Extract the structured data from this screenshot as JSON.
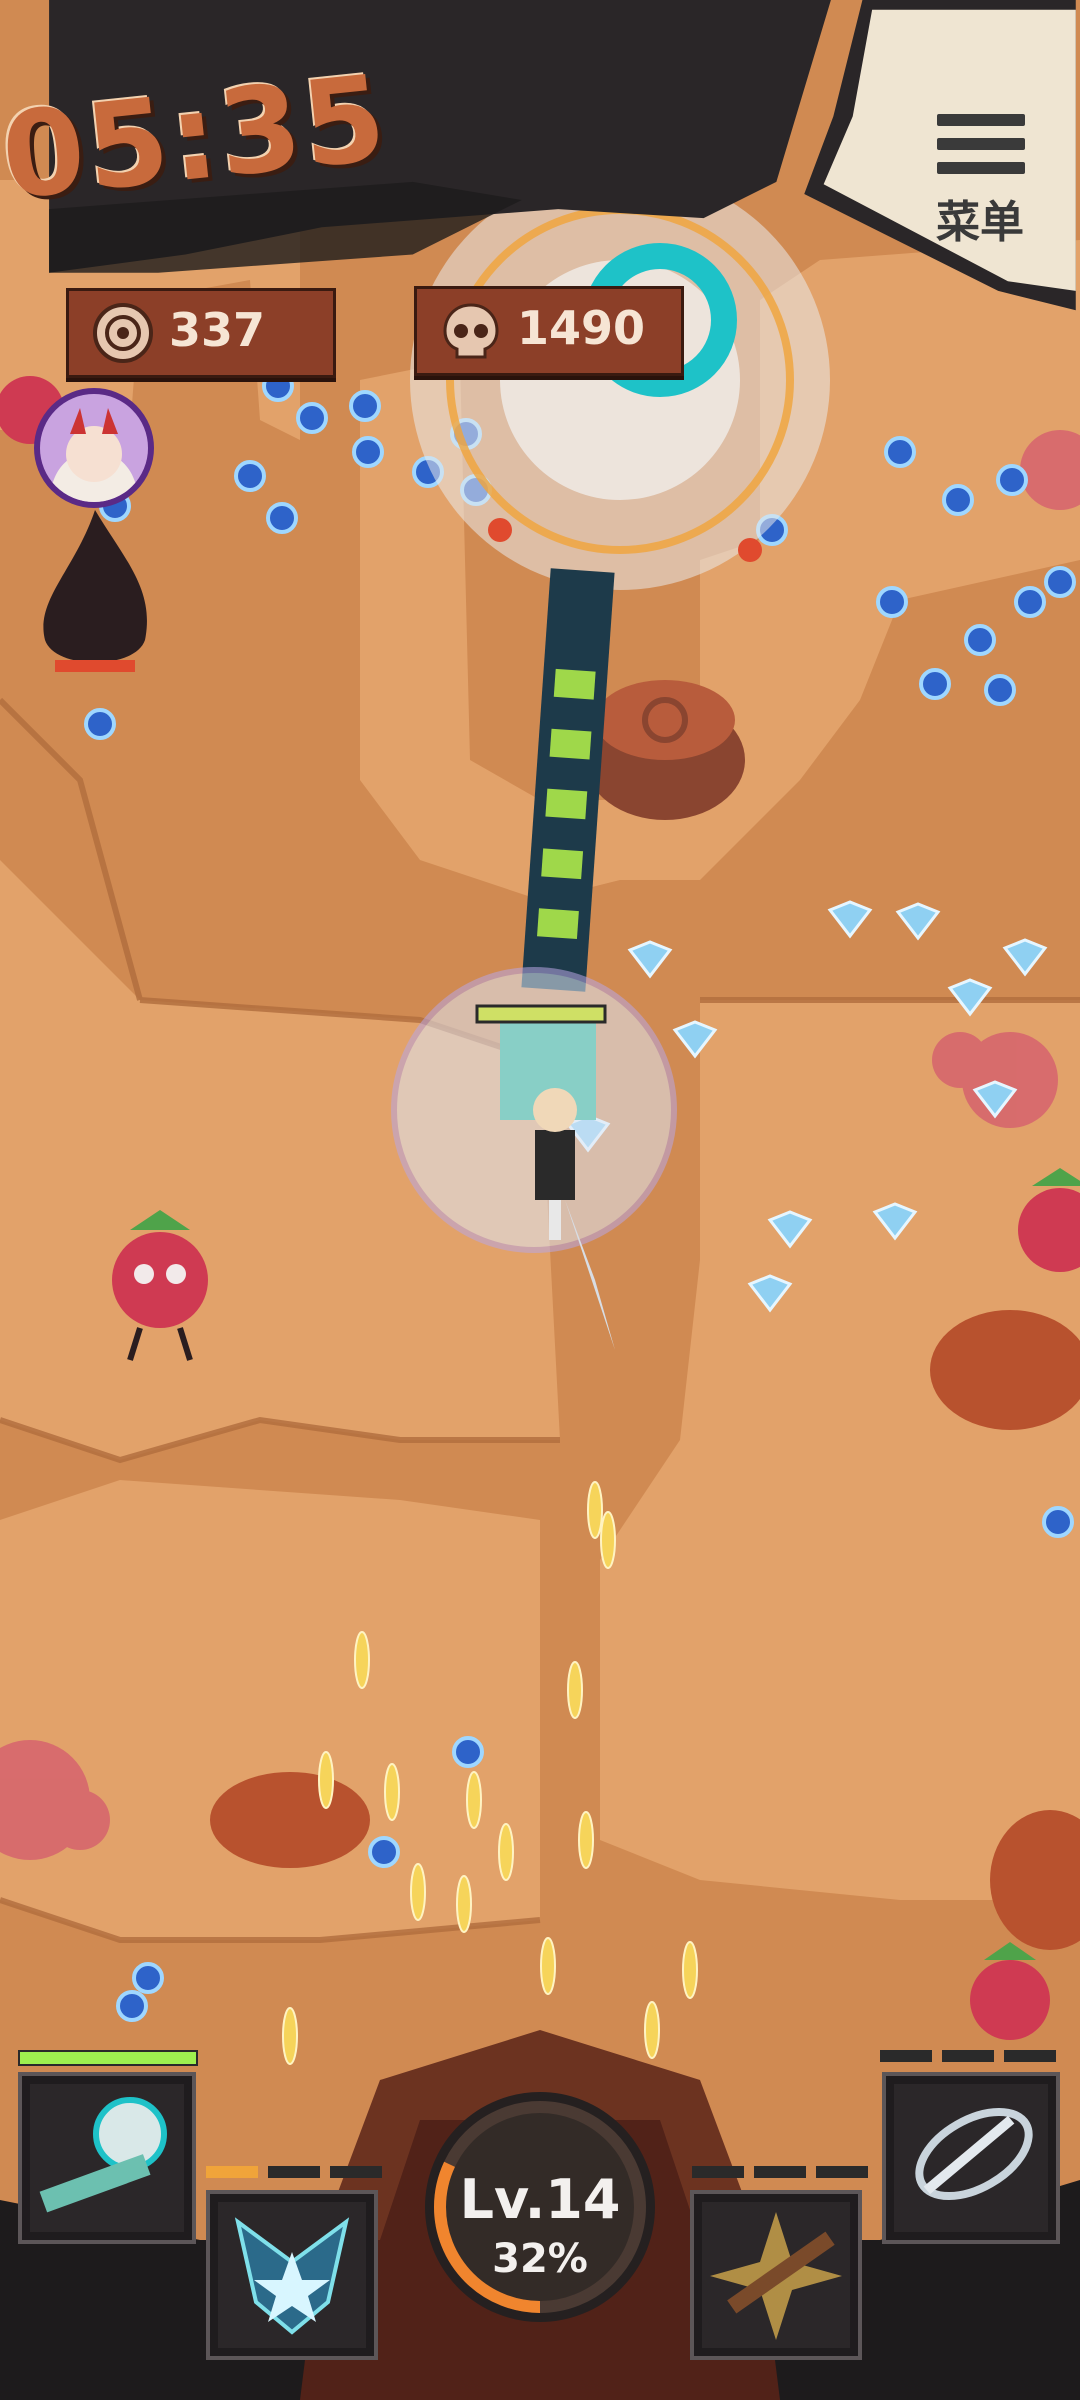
{
  "hud": {
    "timer": "05:35",
    "menu_label": "菜单",
    "coins": "337",
    "kills": "1490"
  },
  "level": {
    "label": "Lv.14",
    "progress_text": "32%",
    "progress": 0.32
  },
  "player": {
    "hp_fraction": 1.0
  },
  "skills": {
    "left_top_pips_active": 1,
    "right_top_pips_active": 0
  },
  "icons": {
    "coin": "coin-eye-icon",
    "kills": "skull-icon",
    "menu": "hamburger-icon"
  },
  "colors": {
    "timer": "#c86a3c",
    "ground": "#d08a52",
    "plank": "#8c3f28",
    "hp": "#9ef04f",
    "level_ring": "#f0852e"
  }
}
